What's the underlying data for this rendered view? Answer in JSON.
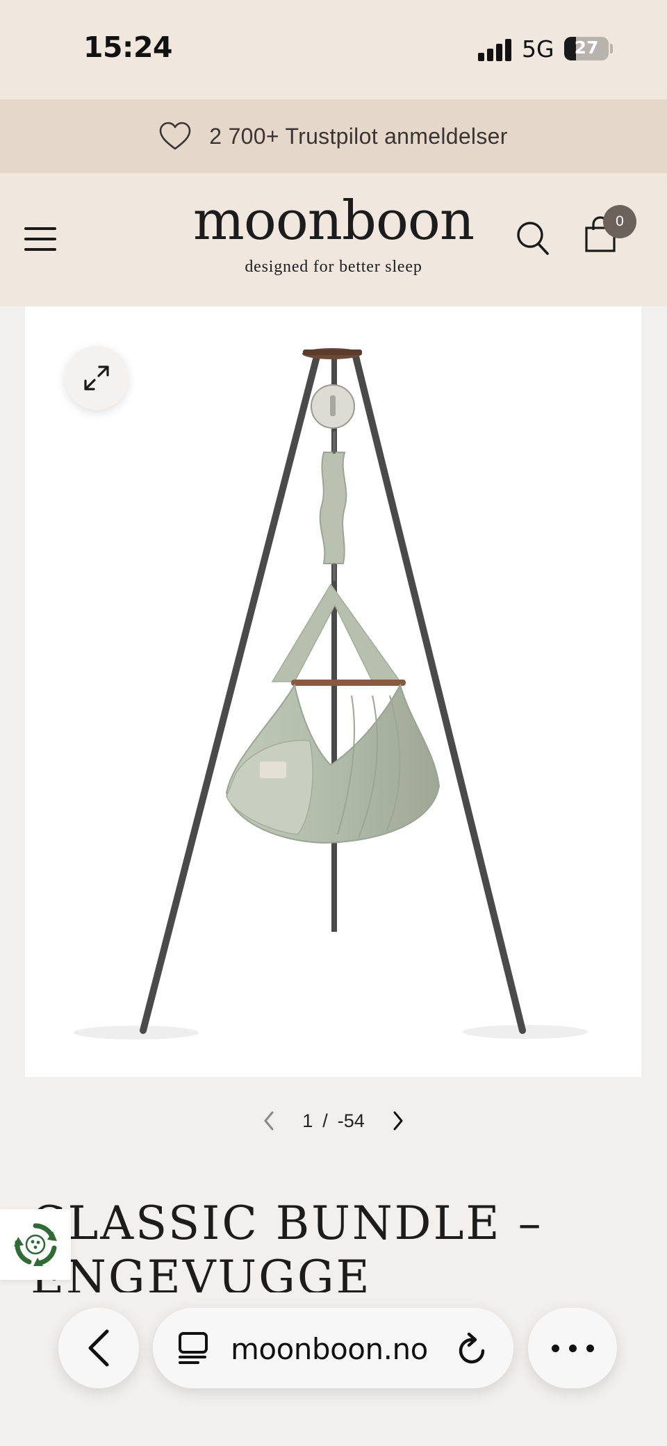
{
  "status_bar": {
    "time": "15:24",
    "network": "5G",
    "battery": "27",
    "battery_level": 0.27
  },
  "promo": {
    "icon": "heart-icon",
    "text": "2 700+ Trustpilot anmeldelser"
  },
  "header": {
    "brand": "moonboon",
    "tagline": "designed for better sleep",
    "menu_icon": "hamburger-icon",
    "search_icon": "search-icon",
    "cart_icon": "shopping-bag-icon",
    "cart_count": "0"
  },
  "gallery": {
    "zoom_icon": "expand-icon",
    "current": "1",
    "separator": "/",
    "total": "-54"
  },
  "product": {
    "title": "CLASSIC BUNDLE – ENGEVUGGE"
  },
  "recycle_widget": {
    "icon": "recycle-icon"
  },
  "browser": {
    "back_icon": "back-icon",
    "tabs_icon": "tabs-icon",
    "url": "moonboon.no",
    "reload_icon": "reload-icon",
    "more_icon": "more-icon"
  },
  "colors": {
    "header_bg": "#f0e7de",
    "promo_bg": "#e5d7c9",
    "page_bg": "#f2f0ee",
    "badge": "#6b625b",
    "recycle_green": "#2e6b35"
  }
}
